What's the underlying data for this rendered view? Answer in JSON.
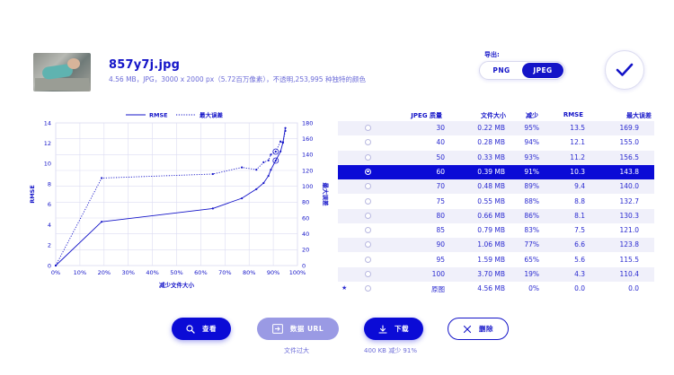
{
  "file": {
    "name": "857y7j.jpg",
    "meta": "4.56 MB，JPG，3000 x 2000 px（5.72百万像素），不透明,253,995 种独特的颜色"
  },
  "export": {
    "label": "导出:",
    "png": "PNG",
    "jpeg": "JPEG",
    "selected": "JPEG"
  },
  "table": {
    "headers": {
      "quality": "JPEG 质量",
      "size": "文件大小",
      "reduction": "减少",
      "rmse": "RMSE",
      "max_error": "最大误差"
    },
    "rows": [
      {
        "quality": "30",
        "size": "0.22 MB",
        "reduction": "95%",
        "rmse": "13.5",
        "max_error": "169.9"
      },
      {
        "quality": "40",
        "size": "0.28 MB",
        "reduction": "94%",
        "rmse": "12.1",
        "max_error": "155.0"
      },
      {
        "quality": "50",
        "size": "0.33 MB",
        "reduction": "93%",
        "rmse": "11.2",
        "max_error": "156.5"
      },
      {
        "quality": "60",
        "size": "0.39 MB",
        "reduction": "91%",
        "rmse": "10.3",
        "max_error": "143.8"
      },
      {
        "quality": "70",
        "size": "0.48 MB",
        "reduction": "89%",
        "rmse": "9.4",
        "max_error": "140.0"
      },
      {
        "quality": "75",
        "size": "0.55 MB",
        "reduction": "88%",
        "rmse": "8.8",
        "max_error": "132.7"
      },
      {
        "quality": "80",
        "size": "0.66 MB",
        "reduction": "86%",
        "rmse": "8.1",
        "max_error": "130.3"
      },
      {
        "quality": "85",
        "size": "0.79 MB",
        "reduction": "83%",
        "rmse": "7.5",
        "max_error": "121.0"
      },
      {
        "quality": "90",
        "size": "1.06 MB",
        "reduction": "77%",
        "rmse": "6.6",
        "max_error": "123.8"
      },
      {
        "quality": "95",
        "size": "1.59 MB",
        "reduction": "65%",
        "rmse": "5.6",
        "max_error": "115.5"
      },
      {
        "quality": "100",
        "size": "3.70 MB",
        "reduction": "19%",
        "rmse": "4.3",
        "max_error": "110.4"
      },
      {
        "quality": "原图",
        "size": "4.56 MB",
        "reduction": "0%",
        "rmse": "0.0",
        "max_error": "0.0",
        "star": "★"
      }
    ],
    "selected_index": 3
  },
  "buttons": {
    "view": "查看",
    "data_url": "数据 URL",
    "download": "下载",
    "delete": "删除"
  },
  "subs": {
    "data_url_note": "文件过大",
    "download_note": "400 KB  减少 91%"
  },
  "colors": {
    "accent": "#0b0bd6",
    "accent_light": "#9a9ae4",
    "text": "#1414c8",
    "grid": "#dcdcf2"
  },
  "chart_data": {
    "type": "line",
    "xlabel": "减少文件大小",
    "ylabel": "RMSE",
    "y2label": "最大误差",
    "xlim": [
      0,
      100
    ],
    "ylim": [
      0,
      14
    ],
    "y2lim": [
      0,
      180
    ],
    "xticks": [
      "0%",
      "10%",
      "20%",
      "30%",
      "40%",
      "50%",
      "60%",
      "70%",
      "80%",
      "90%",
      "100%"
    ],
    "yticks": [
      "0",
      "2",
      "4",
      "6",
      "8",
      "10",
      "12",
      "14"
    ],
    "y2ticks": [
      "0",
      "20",
      "40",
      "60",
      "80",
      "100",
      "120",
      "140",
      "160",
      "180"
    ],
    "grid": true,
    "legend": "top",
    "series": [
      {
        "name": "RMSE",
        "axis": "left",
        "style": "solid",
        "x": [
          0,
          19,
          65,
          77,
          83,
          86,
          88,
          89,
          91,
          93,
          94,
          95
        ],
        "y": [
          0.0,
          4.3,
          5.6,
          6.6,
          7.5,
          8.1,
          8.8,
          9.4,
          10.3,
          11.2,
          12.1,
          13.5
        ]
      },
      {
        "name": "最大误差",
        "axis": "right",
        "style": "dotted",
        "x": [
          0,
          19,
          65,
          77,
          83,
          86,
          88,
          89,
          91,
          93,
          94,
          95
        ],
        "y": [
          0.0,
          110.4,
          115.5,
          123.8,
          121.0,
          130.3,
          132.7,
          140.0,
          143.8,
          156.5,
          155.0,
          169.9
        ]
      }
    ],
    "highlight_x": 91
  }
}
